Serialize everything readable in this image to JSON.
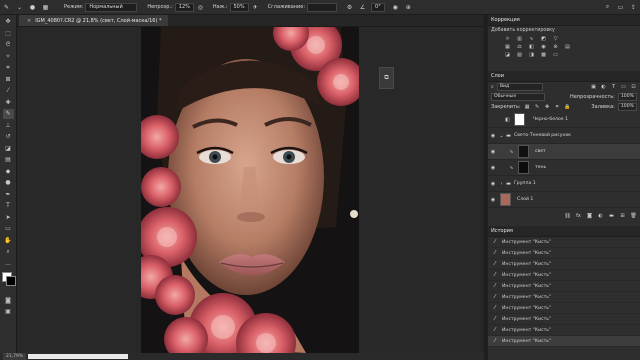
{
  "options_bar": {
    "mode_label": "Режим:",
    "mode_value": "Нормальный",
    "opacity_label": "Непрозр.:",
    "opacity_value": "12%",
    "pressure_label": "Наж.:",
    "pressure_value": "50%",
    "smoothing_label": "Сглаживание:",
    "angle_value": "0°"
  },
  "document_tab": {
    "title": "IGM_4080?.CR2 @ 21,8% (свет, Слой-маска/16) *",
    "close": "×"
  },
  "statusbar": {
    "zoom": "21,79%"
  },
  "adjustments_panel": {
    "tab": "Коррекция",
    "subtitle": "Добавить корректировку"
  },
  "layers_panel": {
    "tab": "Слои",
    "search_kind": "Вид",
    "blend_mode": "Обычные",
    "opacity_label": "Непрозрачность:",
    "opacity_value": "100%",
    "lock_label": "Закрепить:",
    "fill_label": "Заливка:",
    "fill_value": "100%",
    "layers": [
      {
        "name": "Черно-белое 1"
      },
      {
        "name": "Свето-Теневой рисунок"
      },
      {
        "name": "свет"
      },
      {
        "name": "тень"
      },
      {
        "name": "Группа 1"
      },
      {
        "name": "Слой 1"
      }
    ]
  },
  "history_panel": {
    "tab": "История",
    "items": [
      "Инструмент \"Кисть\"",
      "Инструмент \"Кисть\"",
      "Инструмент \"Кисть\"",
      "Инструмент \"Кисть\"",
      "Инструмент \"Кисть\"",
      "Инструмент \"Кисть\"",
      "Инструмент \"Кисть\"",
      "Инструмент \"Кисть\"",
      "Инструмент \"Кисть\"",
      "Инструмент \"Кисть\""
    ]
  }
}
